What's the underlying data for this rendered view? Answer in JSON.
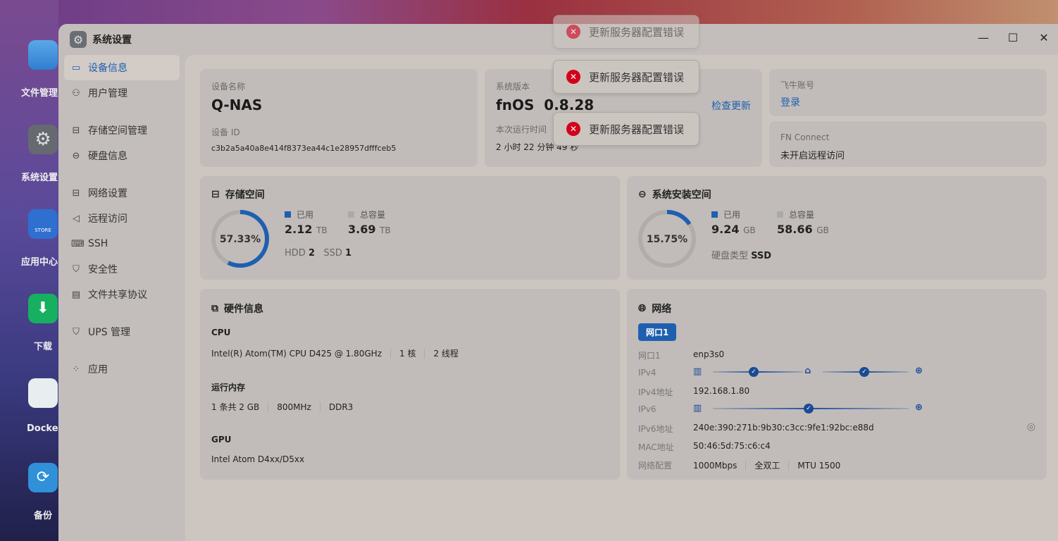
{
  "desktop": {
    "apps": [
      {
        "label": "文件管理"
      },
      {
        "label": "系统设置"
      },
      {
        "label": "应用中心",
        "icon_text": "STORE"
      },
      {
        "label": "下载"
      },
      {
        "label": "Docker"
      },
      {
        "label": "备份"
      }
    ]
  },
  "window": {
    "title": "系统设置"
  },
  "sidebar": {
    "items": [
      {
        "label": "设备信息",
        "icon": "monitor-icon"
      },
      {
        "label": "用户管理",
        "icon": "user-icon"
      },
      {
        "label": "存储空间管理",
        "icon": "storage-icon"
      },
      {
        "label": "硬盘信息",
        "icon": "disk-icon"
      },
      {
        "label": "网络设置",
        "icon": "network-icon"
      },
      {
        "label": "远程访问",
        "icon": "send-icon"
      },
      {
        "label": "SSH",
        "icon": "code-icon"
      },
      {
        "label": "安全性",
        "icon": "shield-check-icon"
      },
      {
        "label": "文件共享协议",
        "icon": "file-icon"
      },
      {
        "label": "UPS 管理",
        "icon": "shield-icon"
      },
      {
        "label": "应用",
        "icon": "grid-icon"
      }
    ]
  },
  "device": {
    "name_label": "设备名称",
    "name": "Q-NAS",
    "id_label": "设备 ID",
    "id": "c3b2a5a40a8e414f8373ea44c1e28957dfffceb5"
  },
  "system": {
    "version_label": "系统版本",
    "os": "fnOS",
    "version": "0.8.28",
    "check_update": "检查更新",
    "uptime_label": "本次运行时间",
    "uptime": "2 小时 22 分钟 49 秒"
  },
  "account": {
    "label": "飞牛账号",
    "login": "登录",
    "fn_label": "FN Connect",
    "fn_status": "未开启远程访问"
  },
  "storage": {
    "title": "存储空间",
    "percent": 57.33,
    "percent_text": "57.33%",
    "used_label": "已用",
    "used": "2.12",
    "used_unit": "TB",
    "total_label": "总容量",
    "total": "3.69",
    "total_unit": "TB",
    "hdd_label": "HDD",
    "hdd": "2",
    "ssd_label": "SSD",
    "ssd": "1"
  },
  "sysspace": {
    "title": "系统安装空间",
    "percent": 15.75,
    "percent_text": "15.75%",
    "used_label": "已用",
    "used": "9.24",
    "used_unit": "GB",
    "total_label": "总容量",
    "total": "58.66",
    "total_unit": "GB",
    "disk_type_label": "硬盘类型",
    "disk_type": "SSD"
  },
  "hardware": {
    "title": "硬件信息",
    "cpu_label": "CPU",
    "cpu": "Intel(R) Atom(TM) CPU D425 @ 1.80GHz",
    "cores": "1 核",
    "threads": "2 线程",
    "mem_label": "运行内存",
    "mem": "1 条共 2 GB",
    "mem_freq": "800MHz",
    "mem_type": "DDR3",
    "gpu_label": "GPU",
    "gpu": "Intel Atom D4xx/D5xx"
  },
  "network": {
    "title": "网络",
    "tab": "网口1",
    "port_label": "网口1",
    "port": "enp3s0",
    "ipv4_label": "IPv4",
    "ipv4_addr_label": "IPv4地址",
    "ipv4_addr": "192.168.1.80",
    "ipv6_label": "IPv6",
    "ipv6_addr_label": "IPv6地址",
    "ipv6_addr": "240e:390:271b:9b30:c3cc:9fe1:92bc:e88d",
    "mac_label": "MAC地址",
    "mac": "50:46:5d:75:c6:c4",
    "config_label": "网络配置",
    "speed": "1000Mbps",
    "duplex": "全双工",
    "mtu": "MTU 1500"
  },
  "toasts": [
    {
      "message": "更新服务器配置错误"
    },
    {
      "message": "更新服务器配置错误"
    },
    {
      "message": "更新服务器配置错误"
    }
  ],
  "colors": {
    "accent": "#1f5fb0",
    "error": "#d4001a",
    "ring_track": "#b0aca9"
  }
}
